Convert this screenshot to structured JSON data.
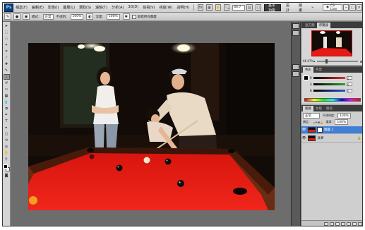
{
  "app": {
    "logo": "Ps"
  },
  "menu": [
    "檔案(F)",
    "編輯(E)",
    "影像(I)",
    "圖層(L)",
    "選取(S)",
    "濾鏡(T)",
    "分析(A)",
    "3D(D)",
    "檢視(V)",
    "視窗(W)",
    "說明(H)"
  ],
  "menubar": {
    "zoom": "66.7",
    "workspaces": [
      "基本功能",
      "設計",
      "繪畫"
    ],
    "active_workspace": "基本功能",
    "more": "»",
    "cslive": "CS Live"
  },
  "options": {
    "mode_label": "模式：",
    "mode_value": "正常",
    "opacity_label": "不透明：",
    "opacity_value": "100%",
    "flow_label": "流量：",
    "flow_value": "100%",
    "sample_label": "對齊",
    "sample_all": "取樣所有圖層"
  },
  "panels": {
    "navigator_tabs": [
      "直方圖",
      "導覽器"
    ],
    "navigator_active": "導覽器",
    "nav_zoom": "66.67%",
    "nav_zoom_fraction": 0.2,
    "color_tabs": [
      "色彩",
      "色票"
    ],
    "color_active": "色彩",
    "color_channels": [
      {
        "label": "R",
        "value": "0",
        "color": "#e03030"
      },
      {
        "label": "G",
        "value": "0",
        "color": "#30a030"
      },
      {
        "label": "B",
        "value": "0",
        "color": "#3050d0"
      }
    ],
    "layers_tabs": [
      "圖層",
      "色版",
      "路徑"
    ],
    "layers_active": "圖層",
    "layers_blend": "正常",
    "layers_opacity_label": "不透明度：",
    "layers_opacity": "100%",
    "layers_fill_label": "填滿：",
    "layers_fill": "100%",
    "layers_lock_label": "鎖定：",
    "layers": [
      {
        "name": "圖層 1",
        "selected": true
      },
      {
        "name": "背景",
        "selected": false
      }
    ]
  },
  "colors": {
    "accent": "#3f7fd6",
    "table_felt": "#e31b14",
    "canvas_bg": "#6d6d6d"
  }
}
